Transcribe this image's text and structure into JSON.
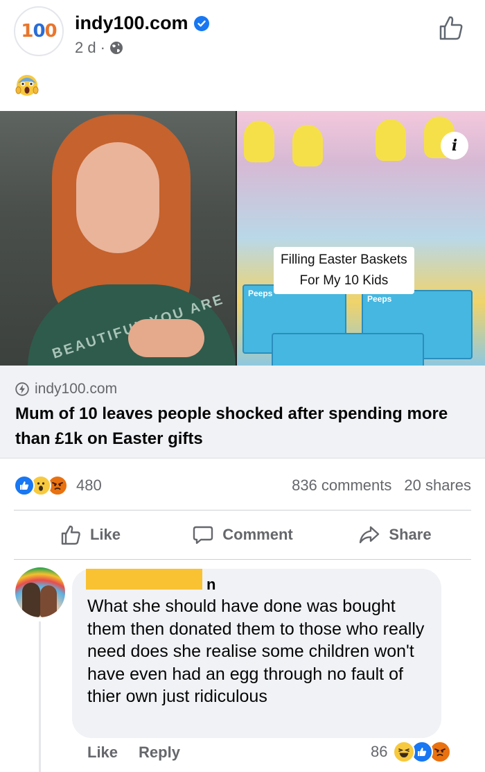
{
  "post": {
    "page_name": "indy100.com",
    "avatar_text": "100",
    "age": "2 d",
    "meta_separator": "·",
    "caption_emoji": "screaming-face"
  },
  "link_preview": {
    "video_caption_line1": "Filling Easter Baskets",
    "video_caption_line2": "For My 10 Kids",
    "shirt_text": "BEAUTIFUL YOU ARE",
    "peeps_label": "Peeps",
    "info_label": "i",
    "domain": "indy100.com",
    "headline": "Mum of 10 leaves people shocked after spending more than £1k on Easter gifts"
  },
  "stats": {
    "reactions": [
      "like",
      "wow",
      "angry"
    ],
    "reaction_count": "480",
    "comments": "836 comments",
    "shares": "20 shares"
  },
  "actions": {
    "like": "Like",
    "comment": "Comment",
    "share": "Share"
  },
  "comment": {
    "author_visible_tail": "n",
    "text": "What she should have done was bought them then donated them to those who really need does she realise some children won't have even had an egg through no fault of thier own just ridiculous",
    "like_label": "Like",
    "reply_label": "Reply",
    "reaction_count": "86",
    "reactions": [
      "haha",
      "like",
      "angry"
    ]
  },
  "colors": {
    "brand_blue": "#1877f2",
    "secondary_text": "#65676b",
    "bubble_bg": "#f0f2f5",
    "redaction": "#f8c233",
    "logo_orange": "#e8762d",
    "logo_blue": "#2a6dd6"
  }
}
